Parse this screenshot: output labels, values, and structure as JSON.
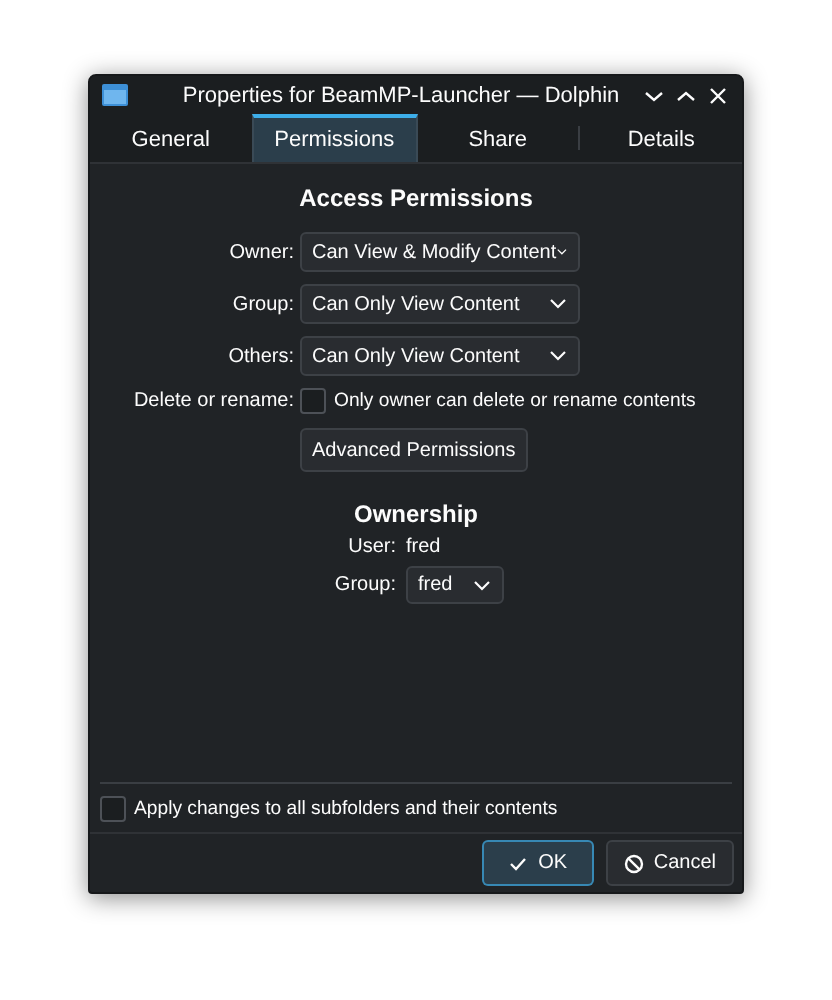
{
  "window": {
    "title": "Properties for BeamMP-Launcher — Dolphin"
  },
  "tabs": [
    {
      "label": "General",
      "selected": false
    },
    {
      "label": "Permissions",
      "selected": true
    },
    {
      "label": "Share",
      "selected": false
    },
    {
      "label": "Details",
      "selected": false
    }
  ],
  "access_permissions": {
    "heading": "Access Permissions",
    "rows": [
      {
        "label": "Owner:",
        "value": "Can View & Modify Content"
      },
      {
        "label": "Group:",
        "value": "Can Only View Content"
      },
      {
        "label": "Others:",
        "value": "Can Only View Content"
      }
    ],
    "delete_rename": {
      "label": "Delete or rename:",
      "checkbox": "Only owner can delete or rename contents",
      "checked": false
    },
    "advanced_button": "Advanced Permissions"
  },
  "ownership": {
    "heading": "Ownership",
    "user_label": "User:",
    "user": "fred",
    "group_label": "Group:",
    "group": "fred"
  },
  "apply_recursive": {
    "label": "Apply changes to all subfolders and their contents",
    "checked": false
  },
  "buttons": [
    {
      "label": "OK",
      "kind": "ok",
      "default": true
    },
    {
      "label": "Cancel",
      "kind": "cancel",
      "default": false
    }
  ]
}
